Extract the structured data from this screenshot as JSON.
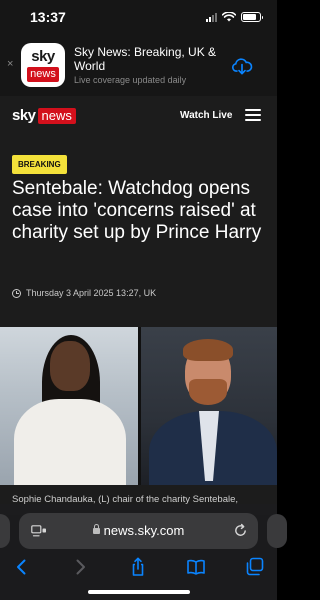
{
  "status_bar": {
    "time": "13:37"
  },
  "app_banner": {
    "title": "Sky News: Breaking, UK & World",
    "subtitle": "Live coverage updated daily",
    "icon_top": "sky",
    "icon_bottom": "news",
    "close_glyph": "×"
  },
  "site_header": {
    "logo_sky": "sky",
    "logo_news": "news",
    "watch_live": "Watch Live"
  },
  "article": {
    "badge": "BREAKING",
    "headline": "Sentebale: Watchdog opens case into 'concerns raised' at charity set up by Prince Harry",
    "date": "Thursday 3 April 2025 13:27, UK",
    "caption": "Sophie Chandauka, (L) chair of the charity Sentebale,"
  },
  "browser": {
    "url": "news.sky.com"
  },
  "colors": {
    "brand_red": "#d3101c",
    "badge_yellow": "#f3e13a",
    "accent_blue": "#0a84ff"
  },
  "icons": [
    "close-icon",
    "download-icon",
    "menu-icon",
    "clock-icon",
    "reader-icon",
    "lock-icon",
    "reload-icon",
    "back-icon",
    "forward-icon",
    "share-icon",
    "bookmarks-icon",
    "tabs-icon"
  ]
}
